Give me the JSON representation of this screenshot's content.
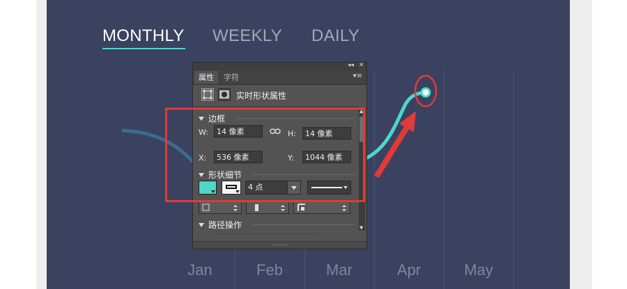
{
  "tabs": [
    {
      "label": "MONTHLY",
      "active": true
    },
    {
      "label": "WEEKLY",
      "active": false
    },
    {
      "label": "DAILY",
      "active": false
    }
  ],
  "chart_data": {
    "type": "line",
    "categories": [
      "Jan",
      "Feb",
      "Mar",
      "Apr",
      "May"
    ],
    "series": [
      {
        "name": "",
        "color": "#4ed6cb",
        "highlighted_point": "Apr"
      }
    ],
    "grid": true
  },
  "panel": {
    "topbar_collapse": "◂◂",
    "topbar_close": "✕",
    "tabs": [
      "属性",
      "字符"
    ],
    "menu_icon": "▾≡",
    "header_title": "实时形状属性",
    "section_bounds": "边框",
    "w_label": "W:",
    "w_value": "14 像素",
    "h_label": "H:",
    "h_value": "14 像素",
    "x_label": "X:",
    "x_value": "536 像素",
    "y_label": "Y:",
    "y_value": "1044 像素",
    "section_shape": "形状细节",
    "fill_color": "#4ed6cb",
    "stroke_width": "4 点",
    "section_path": "路径操作"
  },
  "colors": {
    "background": "#3a4260",
    "accent": "#4ed6cb",
    "annotation": "#e13a3a"
  }
}
